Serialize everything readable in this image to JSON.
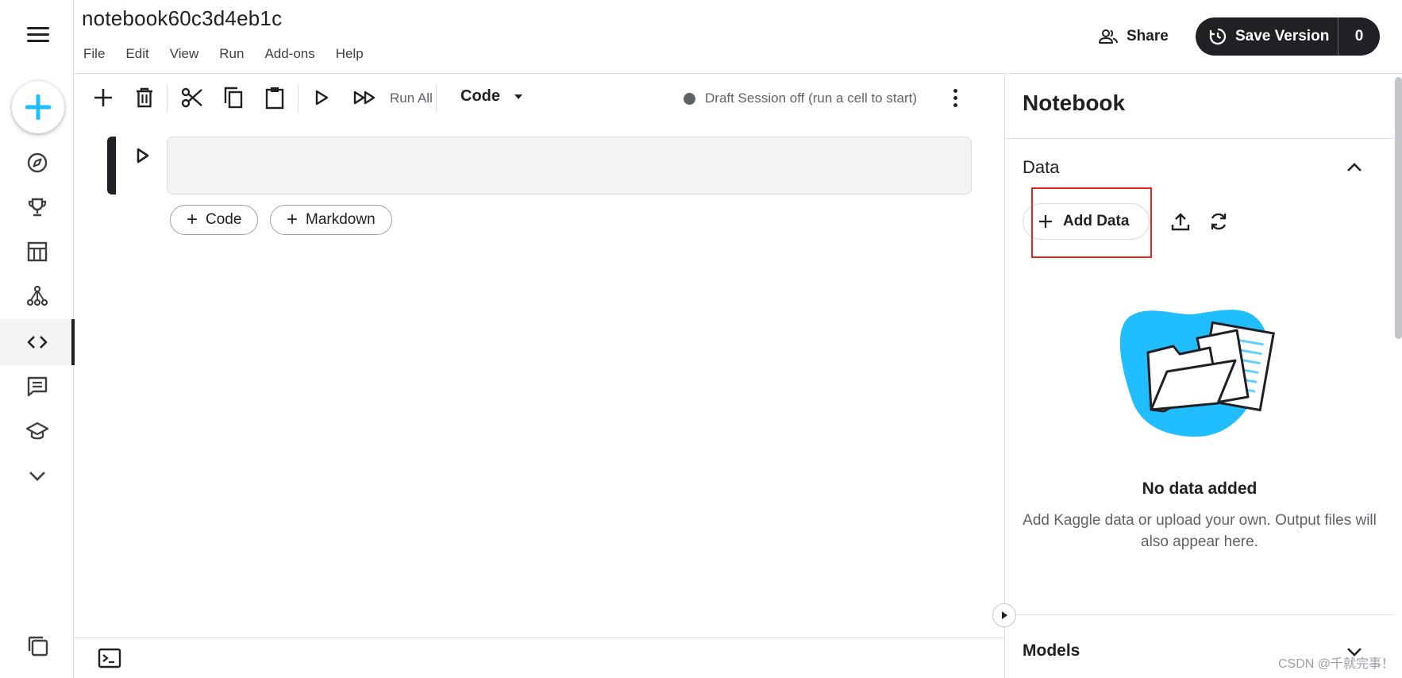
{
  "header": {
    "notebook_title": "notebook60c3d4eb1c",
    "menu": [
      "File",
      "Edit",
      "View",
      "Run",
      "Add-ons",
      "Help"
    ],
    "share_label": "Share",
    "save_version_label": "Save Version",
    "save_version_count": "0"
  },
  "toolbar": {
    "run_all_label": "Run All",
    "cell_type": "Code",
    "session_status": "Draft Session off (run a cell to start)"
  },
  "editor": {
    "add_code_label": "Code",
    "add_markdown_label": "Markdown"
  },
  "panel": {
    "title": "Notebook",
    "data_section_title": "Data",
    "add_data_label": "Add Data",
    "empty_title": "No data added",
    "empty_description": "Add Kaggle data or upload your own. Output files will also appear here.",
    "models_section_title": "Models"
  },
  "watermark": "CSDN @千就完事！",
  "colors": {
    "accent_blue": "#20beff",
    "dark": "#202124",
    "highlight_red": "#e8251f"
  },
  "icons": {
    "rail": [
      "compass-icon",
      "trophy-icon",
      "table-icon",
      "models-icon",
      "code-icon",
      "comments-icon",
      "learn-icon",
      "chevron-down-icon"
    ]
  }
}
